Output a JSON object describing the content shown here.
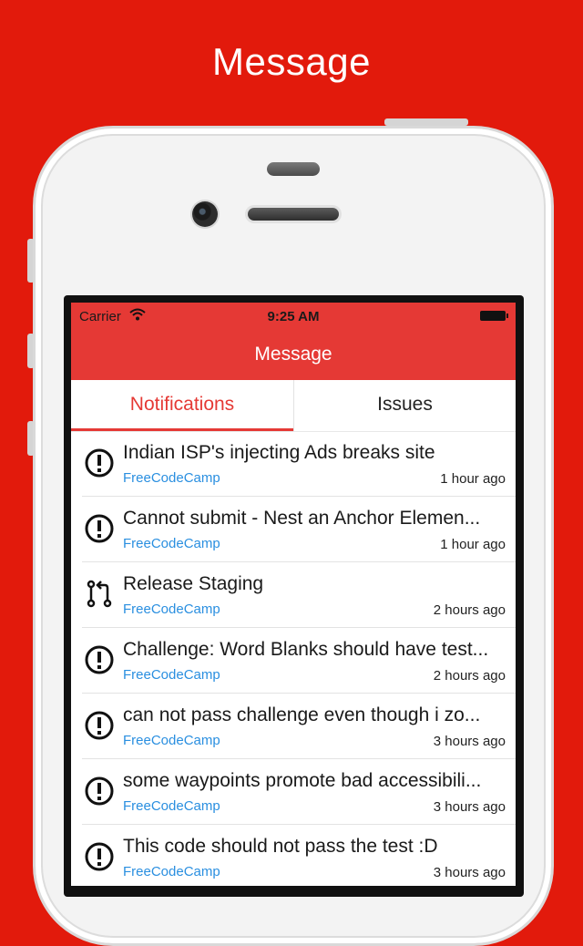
{
  "promo": {
    "title": "Message"
  },
  "status_bar": {
    "carrier": "Carrier",
    "time": "9:25 AM"
  },
  "nav": {
    "title": "Message"
  },
  "tabs": [
    {
      "label": "Notifications",
      "selected": true
    },
    {
      "label": "Issues",
      "selected": false
    }
  ],
  "notifications": [
    {
      "icon": "issue-icon",
      "title": "Indian ISP's injecting Ads breaks site",
      "repo": "FreeCodeCamp",
      "time": "1 hour ago"
    },
    {
      "icon": "issue-icon",
      "title": "Cannot submit - Nest an Anchor Elemen...",
      "repo": "FreeCodeCamp",
      "time": "1 hour ago"
    },
    {
      "icon": "pull-request-icon",
      "title": "Release Staging",
      "repo": "FreeCodeCamp",
      "time": "2 hours ago"
    },
    {
      "icon": "issue-icon",
      "title": "Challenge: Word Blanks should have test...",
      "repo": "FreeCodeCamp",
      "time": "2 hours ago"
    },
    {
      "icon": "issue-icon",
      "title": "can not pass challenge even though i zo...",
      "repo": "FreeCodeCamp",
      "time": "3 hours ago"
    },
    {
      "icon": "issue-icon",
      "title": "some waypoints promote bad accessibili...",
      "repo": "FreeCodeCamp",
      "time": "3 hours ago"
    },
    {
      "icon": "issue-icon",
      "title": "This code should not pass the test :D",
      "repo": "FreeCodeCamp",
      "time": "3 hours ago"
    }
  ],
  "colors": {
    "background": "#e21a0c",
    "accent": "#e53935",
    "repo_link": "#2a8fe0"
  }
}
